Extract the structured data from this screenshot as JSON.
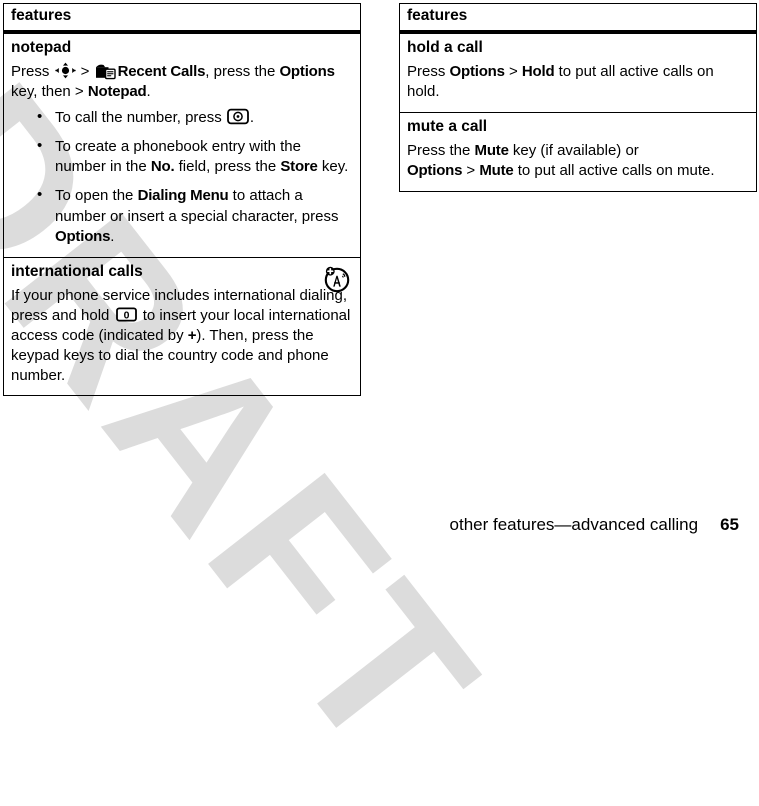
{
  "watermark": {
    "text": "DRAFT"
  },
  "footer": {
    "chapter": "other features—advanced calling",
    "page_number": "65"
  },
  "left_column": {
    "header": "features",
    "rows": [
      {
        "title": "notepad",
        "intro_a": "Press ",
        "nav_icon": "navigation-key-icon",
        "intro_b": " > ",
        "menu_icon": "recent-calls-icon",
        "menu_label": "Recent Calls",
        "intro_c": ", press the ",
        "options_label": "Options",
        "intro_d": " key, then > ",
        "notepad_label": "Notepad",
        "intro_e": ".",
        "bullets": [
          {
            "text_a": "To call the number, press ",
            "icon": "send-key-icon",
            "text_b": "."
          },
          {
            "text_a": "To create a phonebook entry with the number in the ",
            "bold_a": "No.",
            "text_b": " field, press the ",
            "bold_b": "Store",
            "text_c": " key."
          },
          {
            "text_a": "To open the ",
            "bold_a": "Dialing Menu",
            "text_b": " to attach a number or insert a special character, press ",
            "bold_b": "Options",
            "text_c": "."
          }
        ]
      },
      {
        "title": "international calls",
        "icon": "network-plus-icon",
        "body_a": "If your phone service includes international dialing, press and hold ",
        "key_icon": "zero-key-icon",
        "body_b": " to insert your local international access code (indicated by ",
        "bold_plus": "+",
        "body_c": "). Then, press the keypad keys to dial the country code and phone number."
      }
    ]
  },
  "right_column": {
    "header": "features",
    "rows": [
      {
        "title": "hold a call",
        "body_a": "Press ",
        "bold_a": "Options",
        "body_b": " > ",
        "bold_b": "Hold",
        "body_c": " to put all active calls on hold."
      },
      {
        "title": "mute a call",
        "body_a": "Press the ",
        "bold_a": "Mute",
        "body_b": " key (if available) or",
        "bold_c": "Options",
        "body_d": " > ",
        "bold_d": "Mute",
        "body_e": " to put all active calls on mute."
      }
    ]
  },
  "colors": {
    "ink": "#000000",
    "paper": "#ffffff",
    "watermark": "#dcdcdc"
  }
}
